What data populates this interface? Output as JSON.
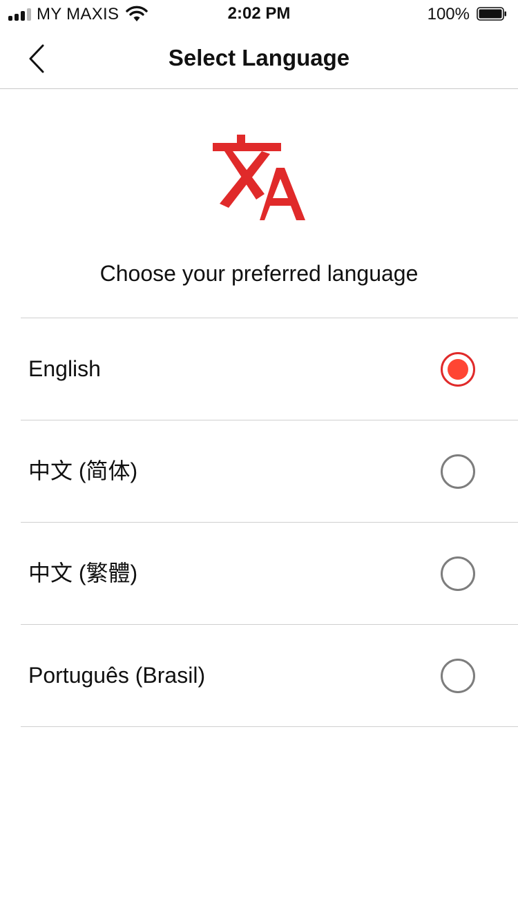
{
  "status_bar": {
    "carrier": "MY MAXIS",
    "time": "2:02 PM",
    "battery_percent": "100%",
    "signal_bars_filled": 3,
    "signal_bars_total": 4,
    "battery_level": 1.0
  },
  "nav": {
    "title": "Select Language",
    "back_icon": "chevron-left-icon"
  },
  "hero": {
    "icon": "translate-icon",
    "subtitle": "Choose your preferred language"
  },
  "languages": [
    {
      "label": "English",
      "selected": true
    },
    {
      "label": "中文 (简体)",
      "selected": false
    },
    {
      "label": "中文 (繁體)",
      "selected": false
    },
    {
      "label": "Português (Brasil)",
      "selected": false
    }
  ],
  "colors": {
    "accent": "#e02a2a",
    "radio_fill": "#ff4533",
    "radio_inactive": "#7d7d7d",
    "text": "#111111",
    "divider": "#cfcfcf"
  }
}
